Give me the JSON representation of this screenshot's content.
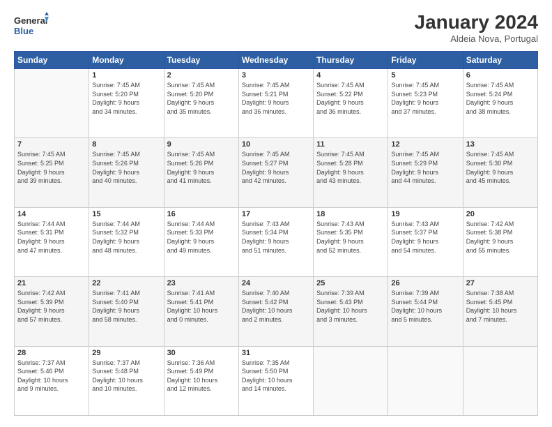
{
  "header": {
    "logo_line1": "General",
    "logo_line2": "Blue",
    "month_year": "January 2024",
    "location": "Aldeia Nova, Portugal"
  },
  "days_of_week": [
    "Sunday",
    "Monday",
    "Tuesday",
    "Wednesday",
    "Thursday",
    "Friday",
    "Saturday"
  ],
  "weeks": [
    [
      {
        "day": "",
        "info": ""
      },
      {
        "day": "1",
        "info": "Sunrise: 7:45 AM\nSunset: 5:20 PM\nDaylight: 9 hours\nand 34 minutes."
      },
      {
        "day": "2",
        "info": "Sunrise: 7:45 AM\nSunset: 5:20 PM\nDaylight: 9 hours\nand 35 minutes."
      },
      {
        "day": "3",
        "info": "Sunrise: 7:45 AM\nSunset: 5:21 PM\nDaylight: 9 hours\nand 36 minutes."
      },
      {
        "day": "4",
        "info": "Sunrise: 7:45 AM\nSunset: 5:22 PM\nDaylight: 9 hours\nand 36 minutes."
      },
      {
        "day": "5",
        "info": "Sunrise: 7:45 AM\nSunset: 5:23 PM\nDaylight: 9 hours\nand 37 minutes."
      },
      {
        "day": "6",
        "info": "Sunrise: 7:45 AM\nSunset: 5:24 PM\nDaylight: 9 hours\nand 38 minutes."
      }
    ],
    [
      {
        "day": "7",
        "info": "Sunrise: 7:45 AM\nSunset: 5:25 PM\nDaylight: 9 hours\nand 39 minutes."
      },
      {
        "day": "8",
        "info": "Sunrise: 7:45 AM\nSunset: 5:26 PM\nDaylight: 9 hours\nand 40 minutes."
      },
      {
        "day": "9",
        "info": "Sunrise: 7:45 AM\nSunset: 5:26 PM\nDaylight: 9 hours\nand 41 minutes."
      },
      {
        "day": "10",
        "info": "Sunrise: 7:45 AM\nSunset: 5:27 PM\nDaylight: 9 hours\nand 42 minutes."
      },
      {
        "day": "11",
        "info": "Sunrise: 7:45 AM\nSunset: 5:28 PM\nDaylight: 9 hours\nand 43 minutes."
      },
      {
        "day": "12",
        "info": "Sunrise: 7:45 AM\nSunset: 5:29 PM\nDaylight: 9 hours\nand 44 minutes."
      },
      {
        "day": "13",
        "info": "Sunrise: 7:45 AM\nSunset: 5:30 PM\nDaylight: 9 hours\nand 45 minutes."
      }
    ],
    [
      {
        "day": "14",
        "info": "Sunrise: 7:44 AM\nSunset: 5:31 PM\nDaylight: 9 hours\nand 47 minutes."
      },
      {
        "day": "15",
        "info": "Sunrise: 7:44 AM\nSunset: 5:32 PM\nDaylight: 9 hours\nand 48 minutes."
      },
      {
        "day": "16",
        "info": "Sunrise: 7:44 AM\nSunset: 5:33 PM\nDaylight: 9 hours\nand 49 minutes."
      },
      {
        "day": "17",
        "info": "Sunrise: 7:43 AM\nSunset: 5:34 PM\nDaylight: 9 hours\nand 51 minutes."
      },
      {
        "day": "18",
        "info": "Sunrise: 7:43 AM\nSunset: 5:35 PM\nDaylight: 9 hours\nand 52 minutes."
      },
      {
        "day": "19",
        "info": "Sunrise: 7:43 AM\nSunset: 5:37 PM\nDaylight: 9 hours\nand 54 minutes."
      },
      {
        "day": "20",
        "info": "Sunrise: 7:42 AM\nSunset: 5:38 PM\nDaylight: 9 hours\nand 55 minutes."
      }
    ],
    [
      {
        "day": "21",
        "info": "Sunrise: 7:42 AM\nSunset: 5:39 PM\nDaylight: 9 hours\nand 57 minutes."
      },
      {
        "day": "22",
        "info": "Sunrise: 7:41 AM\nSunset: 5:40 PM\nDaylight: 9 hours\nand 58 minutes."
      },
      {
        "day": "23",
        "info": "Sunrise: 7:41 AM\nSunset: 5:41 PM\nDaylight: 10 hours\nand 0 minutes."
      },
      {
        "day": "24",
        "info": "Sunrise: 7:40 AM\nSunset: 5:42 PM\nDaylight: 10 hours\nand 2 minutes."
      },
      {
        "day": "25",
        "info": "Sunrise: 7:39 AM\nSunset: 5:43 PM\nDaylight: 10 hours\nand 3 minutes."
      },
      {
        "day": "26",
        "info": "Sunrise: 7:39 AM\nSunset: 5:44 PM\nDaylight: 10 hours\nand 5 minutes."
      },
      {
        "day": "27",
        "info": "Sunrise: 7:38 AM\nSunset: 5:45 PM\nDaylight: 10 hours\nand 7 minutes."
      }
    ],
    [
      {
        "day": "28",
        "info": "Sunrise: 7:37 AM\nSunset: 5:46 PM\nDaylight: 10 hours\nand 9 minutes."
      },
      {
        "day": "29",
        "info": "Sunrise: 7:37 AM\nSunset: 5:48 PM\nDaylight: 10 hours\nand 10 minutes."
      },
      {
        "day": "30",
        "info": "Sunrise: 7:36 AM\nSunset: 5:49 PM\nDaylight: 10 hours\nand 12 minutes."
      },
      {
        "day": "31",
        "info": "Sunrise: 7:35 AM\nSunset: 5:50 PM\nDaylight: 10 hours\nand 14 minutes."
      },
      {
        "day": "",
        "info": ""
      },
      {
        "day": "",
        "info": ""
      },
      {
        "day": "",
        "info": ""
      }
    ]
  ]
}
